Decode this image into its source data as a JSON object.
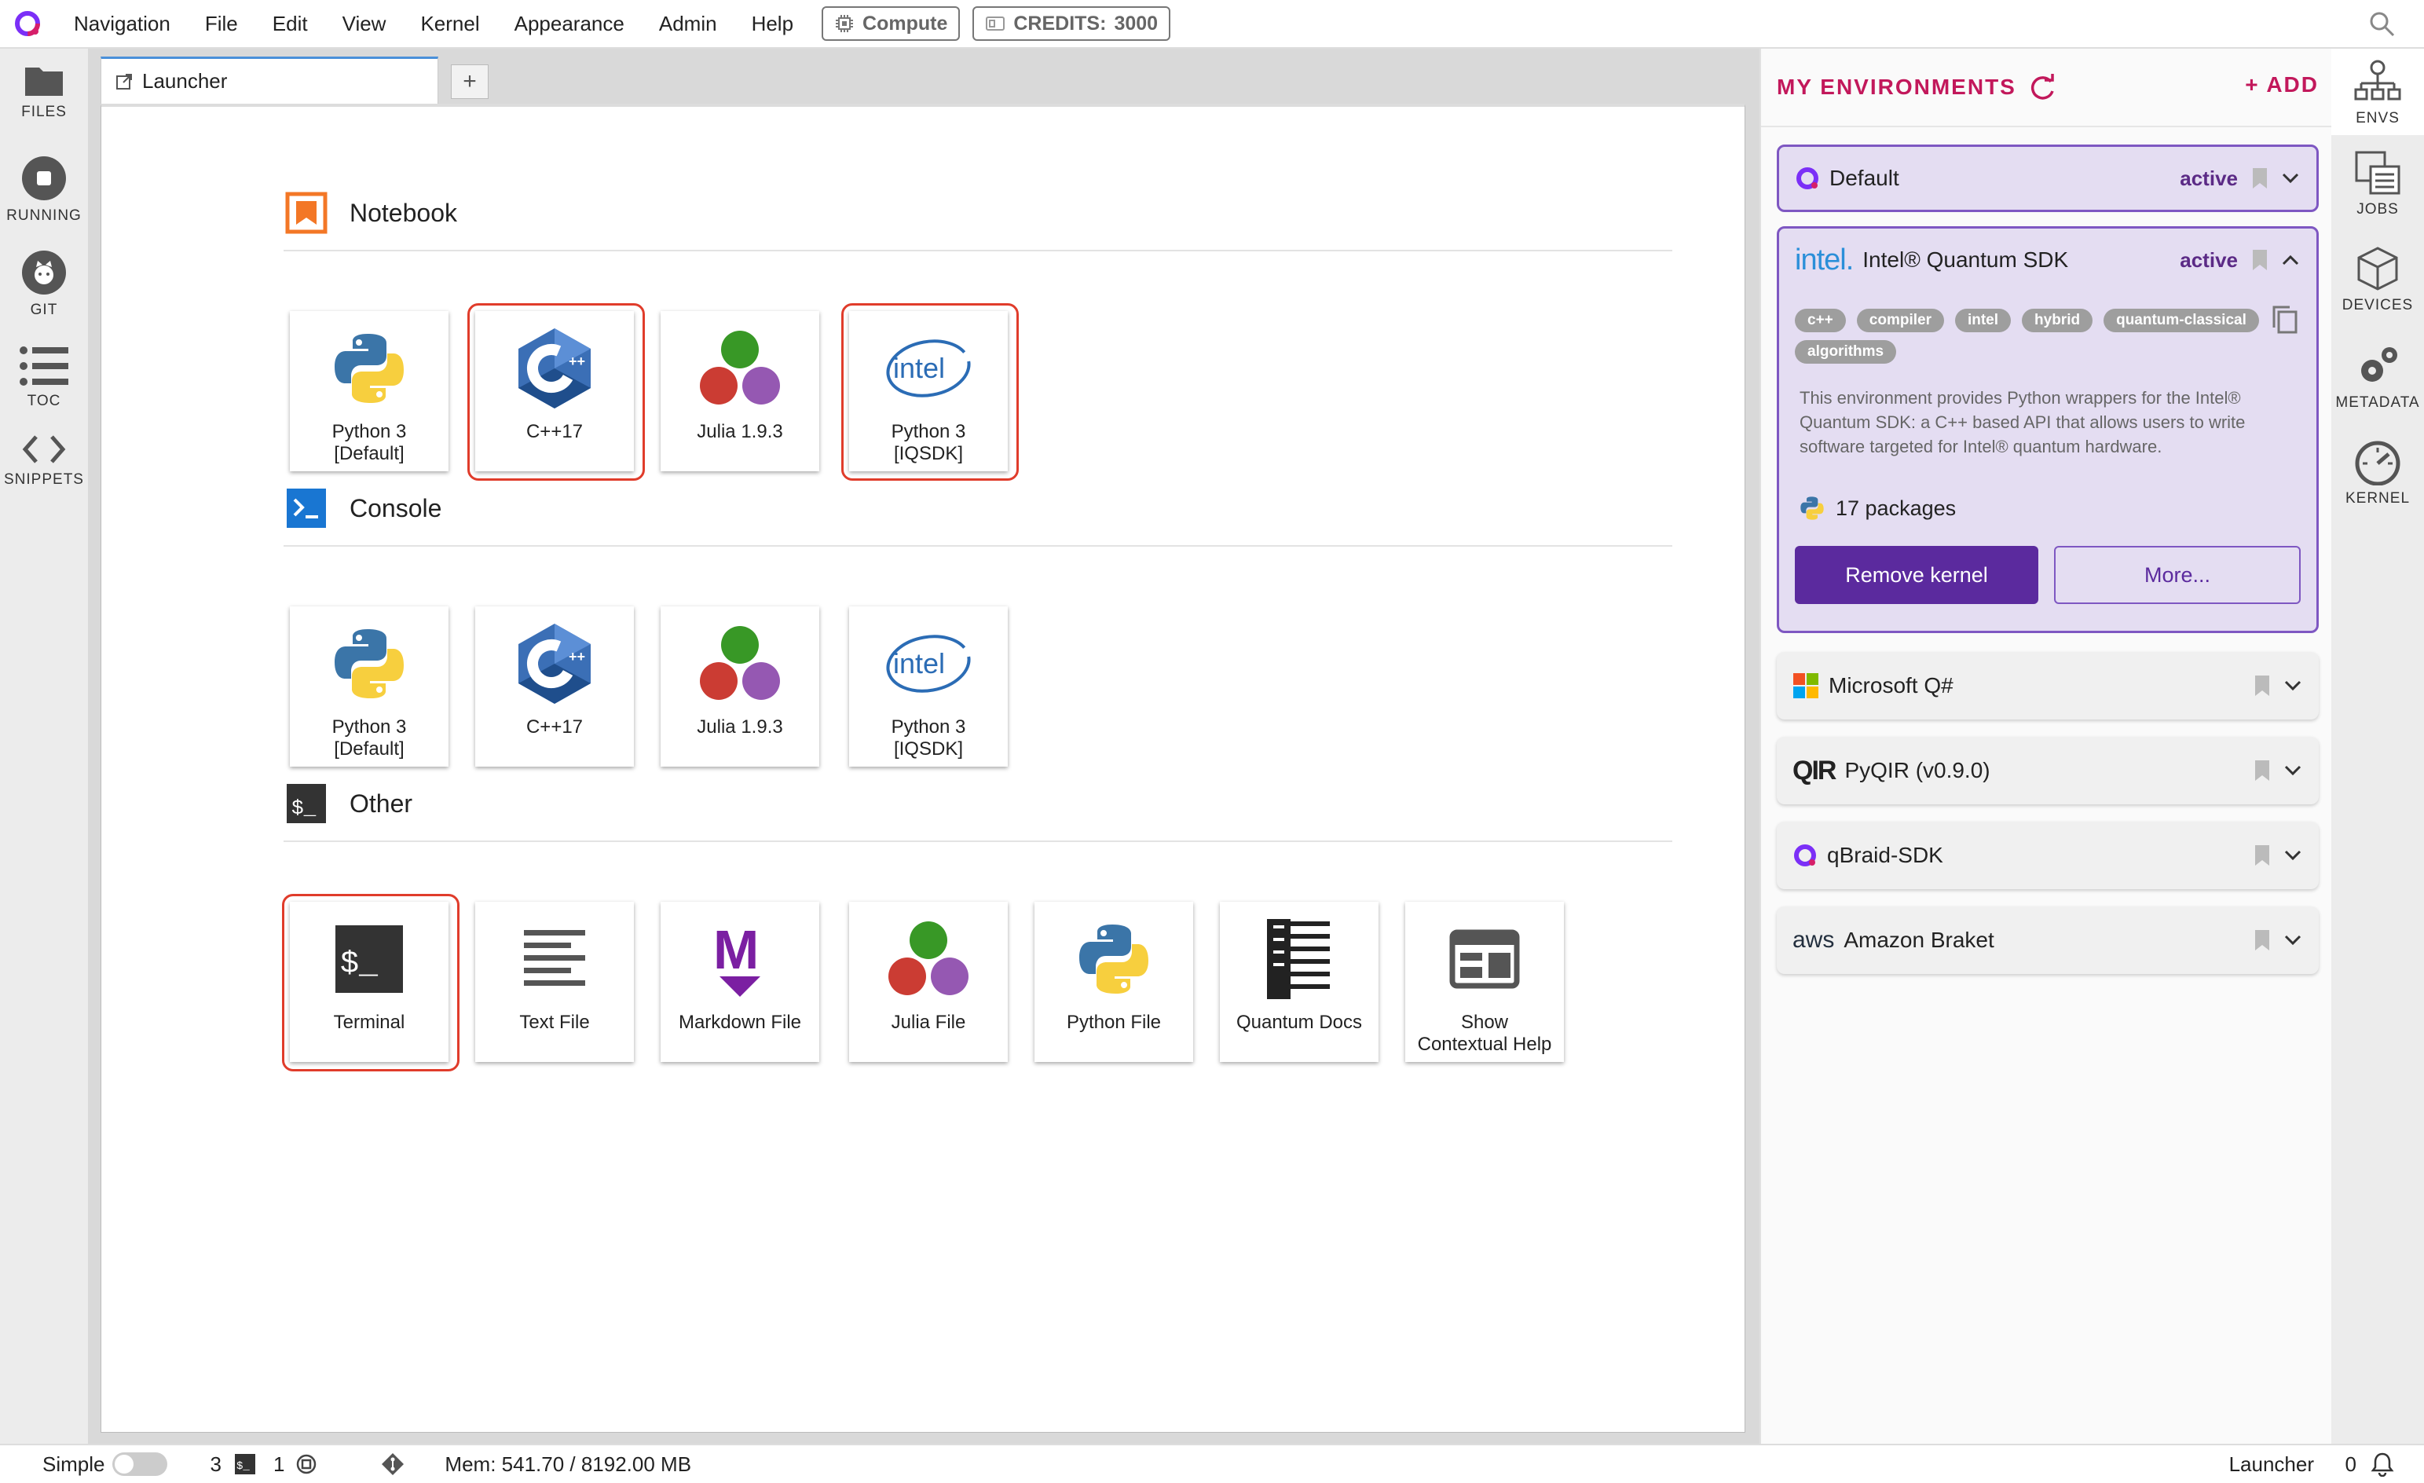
{
  "menubar": {
    "items": [
      "Navigation",
      "File",
      "Edit",
      "View",
      "Kernel",
      "Appearance",
      "Admin",
      "Help"
    ],
    "compute_label": "Compute",
    "credits_label": "CREDITS:",
    "credits_value": "3000"
  },
  "leftbar": {
    "items": [
      "FILES",
      "RUNNING",
      "GIT",
      "TOC",
      "SNIPPETS"
    ]
  },
  "tabs": {
    "launcher_label": "Launcher",
    "add_label": "+"
  },
  "launcher": {
    "notebook_title": "Notebook",
    "console_title": "Console",
    "other_title": "Other",
    "notebook_cards": [
      {
        "l1": "Python 3",
        "l2": "[Default]"
      },
      {
        "l1": "C++17",
        "l2": ""
      },
      {
        "l1": "Julia 1.9.3",
        "l2": ""
      },
      {
        "l1": "Python 3",
        "l2": "[IQSDK]"
      }
    ],
    "console_cards": [
      {
        "l1": "Python 3",
        "l2": "[Default]"
      },
      {
        "l1": "C++17",
        "l2": ""
      },
      {
        "l1": "Julia 1.9.3",
        "l2": ""
      },
      {
        "l1": "Python 3",
        "l2": "[IQSDK]"
      }
    ],
    "other_cards": [
      {
        "l1": "Terminal",
        "l2": ""
      },
      {
        "l1": "Text File",
        "l2": ""
      },
      {
        "l1": "Markdown File",
        "l2": ""
      },
      {
        "l1": "Julia File",
        "l2": ""
      },
      {
        "l1": "Python File",
        "l2": ""
      },
      {
        "l1": "Quantum Docs",
        "l2": ""
      },
      {
        "l1": "Show",
        "l2": "Contextual Help"
      }
    ],
    "intel_logo_text": "intel",
    "cpp_logo_text": "C",
    "terminal_glyph": "$_",
    "markdown_glyph": "M"
  },
  "environments": {
    "title": "MY ENVIRONMENTS",
    "add_label": "+ ADD",
    "default": {
      "name": "Default",
      "status": "active"
    },
    "intel": {
      "logo": "intel.",
      "name": "Intel® Quantum SDK",
      "status": "active",
      "tags": [
        "c++",
        "compiler",
        "intel",
        "hybrid",
        "quantum-classical",
        "algorithms"
      ],
      "description": "This environment provides Python wrappers for the Intel® Quantum SDK: a C++ based API that allows users to write software targeted for Intel® quantum hardware.",
      "packages": "17 packages",
      "remove_label": "Remove kernel",
      "more_label": "More..."
    },
    "others": [
      {
        "name": "Microsoft Q#"
      },
      {
        "name": "PyQIR (v0.9.0)",
        "logo": "QIR"
      },
      {
        "name": "qBraid-SDK"
      },
      {
        "name": "Amazon Braket",
        "logo": "aws"
      }
    ]
  },
  "farright": {
    "items": [
      "ENVS",
      "JOBS",
      "DEVICES",
      "METADATA",
      "KERNEL"
    ]
  },
  "statusbar": {
    "mode": "Simple",
    "terminals": "3",
    "kernels": "1",
    "mem": "Mem: 541.70 / 8192.00 MB",
    "right_label": "Launcher",
    "notifications": "0"
  },
  "colors": {
    "accent": "#c2185b",
    "purple": "#5b2a9e",
    "highlight": "#e03c2b"
  }
}
